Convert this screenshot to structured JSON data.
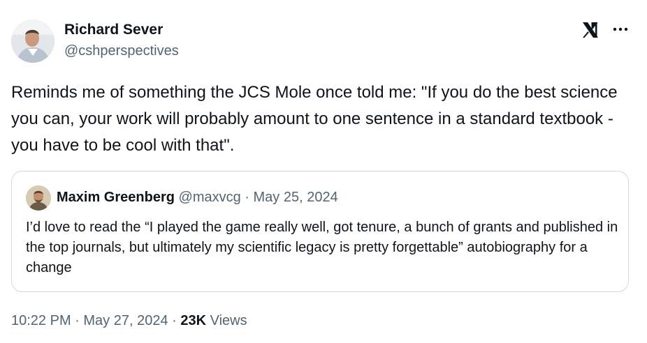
{
  "author": {
    "name": "Richard Sever",
    "handle": "@cshperspectives"
  },
  "tweet": {
    "text": "Reminds me of something the JCS Mole once told me: \"If you do the best science you can, your work will probably amount to one sentence in a standard textbook - you have to be cool with that\"."
  },
  "quoted": {
    "name": "Maxim Greenberg",
    "handle": "@maxvcg",
    "separator": " · ",
    "date": "May 25, 2024",
    "text": "I’d love to read the “I played the game really well, got tenure, a bunch of grants and published in the top journals, but ultimately my scientific legacy is pretty forgettable” autobiography for a change"
  },
  "meta": {
    "time": "10:22 PM",
    "sep1": " · ",
    "date": "May 27, 2024",
    "sep2": " · ",
    "views_count": "23K",
    "views_label": " Views"
  },
  "icons": {
    "brand": "x-logo-icon",
    "menu": "more-options-icon"
  },
  "colors": {
    "text_primary": "#0f1419",
    "text_secondary": "#536471",
    "border": "#cfd9de"
  }
}
